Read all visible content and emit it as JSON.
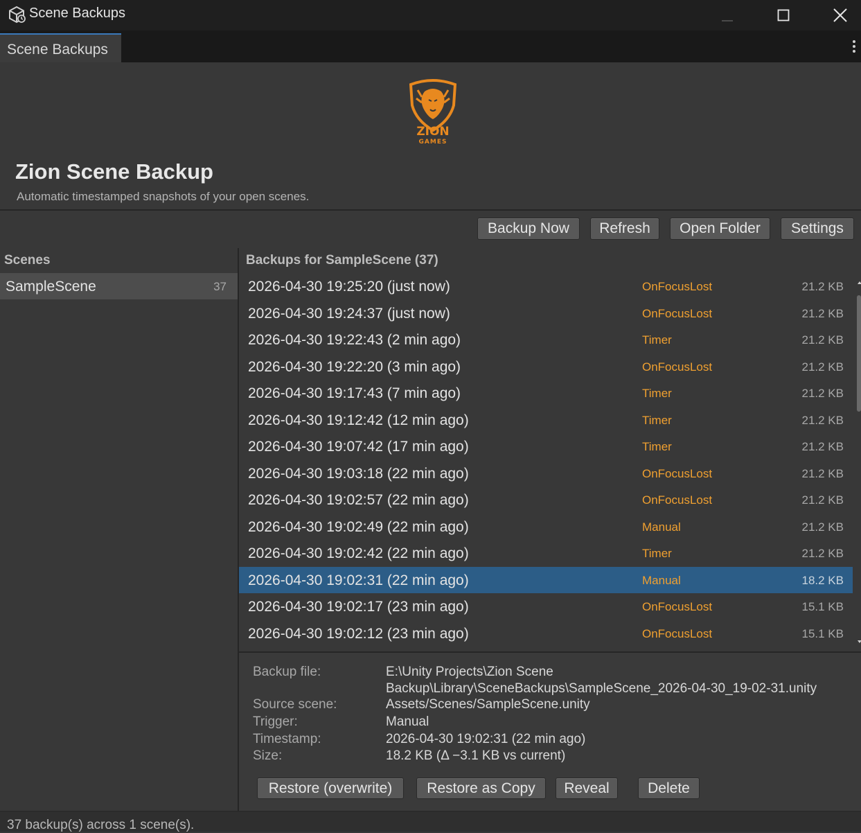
{
  "window": {
    "title": "Scene Backups",
    "icon": "unity-cube-icon"
  },
  "tab": {
    "label": "Scene Backups"
  },
  "header": {
    "logo_text_1": "ZION",
    "logo_text_2": "GAMES",
    "title": "Zion Scene Backup",
    "subtitle": "Automatic timestamped snapshots of your open scenes."
  },
  "toolbar": {
    "backup_now": "Backup Now",
    "refresh": "Refresh",
    "open_folder": "Open Folder",
    "settings": "Settings"
  },
  "scenes_panel": {
    "header": "Scenes",
    "items": [
      {
        "name": "SampleScene",
        "count": "37"
      }
    ]
  },
  "backups": {
    "header": "Backups for SampleScene (37)",
    "rows": [
      {
        "ts": "2026-04-30 19:25:20 (just now)",
        "trigger": "OnFocusLost",
        "size": "21.2 KB"
      },
      {
        "ts": "2026-04-30 19:24:37 (just now)",
        "trigger": "OnFocusLost",
        "size": "21.2 KB"
      },
      {
        "ts": "2026-04-30 19:22:43 (2 min ago)",
        "trigger": "Timer",
        "size": "21.2 KB"
      },
      {
        "ts": "2026-04-30 19:22:20 (3 min ago)",
        "trigger": "OnFocusLost",
        "size": "21.2 KB"
      },
      {
        "ts": "2026-04-30 19:17:43 (7 min ago)",
        "trigger": "Timer",
        "size": "21.2 KB"
      },
      {
        "ts": "2026-04-30 19:12:42 (12 min ago)",
        "trigger": "Timer",
        "size": "21.2 KB"
      },
      {
        "ts": "2026-04-30 19:07:42 (17 min ago)",
        "trigger": "Timer",
        "size": "21.2 KB"
      },
      {
        "ts": "2026-04-30 19:03:18 (22 min ago)",
        "trigger": "OnFocusLost",
        "size": "21.2 KB"
      },
      {
        "ts": "2026-04-30 19:02:57 (22 min ago)",
        "trigger": "OnFocusLost",
        "size": "21.2 KB"
      },
      {
        "ts": "2026-04-30 19:02:49 (22 min ago)",
        "trigger": "Manual",
        "size": "21.2 KB"
      },
      {
        "ts": "2026-04-30 19:02:42 (22 min ago)",
        "trigger": "Timer",
        "size": "21.2 KB"
      },
      {
        "ts": "2026-04-30 19:02:31 (22 min ago)",
        "trigger": "Manual",
        "size": "18.2 KB",
        "selected": true
      },
      {
        "ts": "2026-04-30 19:02:17 (23 min ago)",
        "trigger": "OnFocusLost",
        "size": "15.1 KB"
      },
      {
        "ts": "2026-04-30 19:02:12 (23 min ago)",
        "trigger": "OnFocusLost",
        "size": "15.1 KB"
      }
    ]
  },
  "details": {
    "backup_file_label": "Backup file:",
    "backup_file_line1": "E:\\Unity Projects\\Zion Scene",
    "backup_file_line2": "Backup\\Library\\SceneBackups\\SampleScene_2026-04-30_19-02-31.unity",
    "source_scene_label": "Source scene:",
    "source_scene": "Assets/Scenes/SampleScene.unity",
    "trigger_label": "Trigger:",
    "trigger": "Manual",
    "timestamp_label": "Timestamp:",
    "timestamp": "2026-04-30 19:02:31 (22 min ago)",
    "size_label": "Size:",
    "size": "18.2 KB (Δ −3.1 KB vs current)",
    "buttons": {
      "restore_overwrite": "Restore (overwrite)",
      "restore_copy": "Restore as Copy",
      "reveal": "Reveal",
      "delete": "Delete"
    }
  },
  "status": {
    "text": "37 backup(s) across 1 scene(s)."
  },
  "colors": {
    "trigger": "#f0a030",
    "selection": "#2c5d87",
    "tab_accent": "#3a79bb",
    "logo": "#e8891f"
  }
}
